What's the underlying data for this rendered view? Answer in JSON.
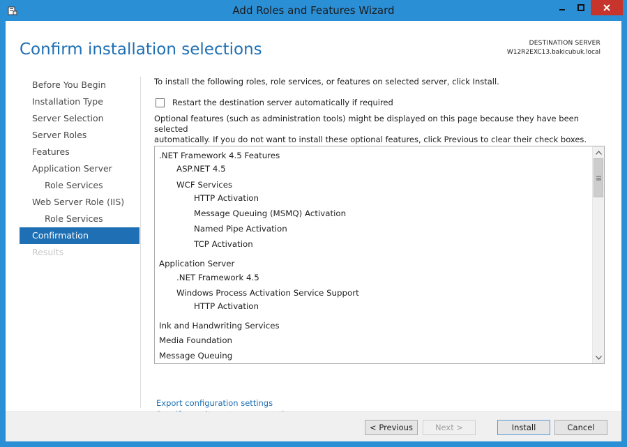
{
  "window": {
    "title": "Add Roles and Features Wizard"
  },
  "header": {
    "page_title": "Confirm installation selections",
    "destination_label": "DESTINATION SERVER",
    "destination_server": "W12R2EXC13.bakicubuk.local"
  },
  "nav": {
    "items": [
      {
        "label": "Before You Begin"
      },
      {
        "label": "Installation Type"
      },
      {
        "label": "Server Selection"
      },
      {
        "label": "Server Roles"
      },
      {
        "label": "Features"
      },
      {
        "label": "Application Server"
      },
      {
        "label": "Role Services"
      },
      {
        "label": "Web Server Role (IIS)"
      },
      {
        "label": "Role Services"
      },
      {
        "label": "Confirmation"
      },
      {
        "label": "Results"
      }
    ],
    "active": "Confirmation"
  },
  "content": {
    "intro": "To install the following roles, role services, or features on selected server, click Install.",
    "restart_label": "Restart the destination server automatically if required",
    "restart_checked": false,
    "optional_line1": "Optional features (such as administration tools) might be displayed on this page because they have been selected",
    "optional_line2": "automatically. If you do not want to install these optional features, click Previous to clear their check boxes.",
    "features": [
      {
        "label": ".NET Framework 4.5 Features",
        "level": 0
      },
      {
        "label": "ASP.NET 4.5",
        "level": 1
      },
      {
        "label": "WCF Services",
        "level": 1
      },
      {
        "label": "HTTP Activation",
        "level": 2
      },
      {
        "label": "Message Queuing (MSMQ) Activation",
        "level": 2
      },
      {
        "label": "Named Pipe Activation",
        "level": 2
      },
      {
        "label": "TCP Activation",
        "level": 2
      },
      {
        "label": "Application Server",
        "level": 0
      },
      {
        "label": ".NET Framework 4.5",
        "level": 1
      },
      {
        "label": "Windows Process Activation Service Support",
        "level": 1
      },
      {
        "label": "HTTP Activation",
        "level": 2
      },
      {
        "label": "Ink and Handwriting Services",
        "level": 0
      },
      {
        "label": "Media Foundation",
        "level": 0
      },
      {
        "label": "Message Queuing",
        "level": 0
      }
    ],
    "export_link": "Export configuration settings",
    "alt_source_link": "Specify an alternate source path"
  },
  "footer": {
    "previous": "< Previous",
    "next": "Next >",
    "install": "Install",
    "cancel": "Cancel"
  },
  "colors": {
    "accent": "#1e6fb4",
    "titlebar": "#2b8fd6",
    "close": "#c7342b"
  }
}
